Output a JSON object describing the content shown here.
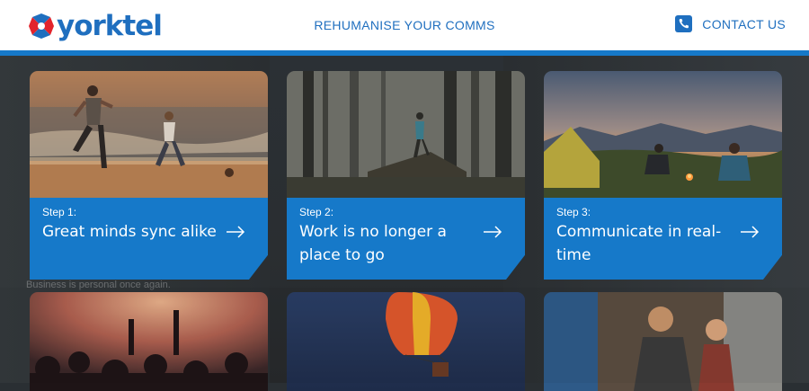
{
  "header": {
    "logo_text": "yorktel",
    "center_link": "REHUMANISE YOUR COMMS",
    "contact_label": "CONTACT US",
    "contact_icon": "phone-icon"
  },
  "background_text": {
    "line1": "Business is personal once again."
  },
  "cards": [
    {
      "step": "Step 1:",
      "title": "Great minds sync alike",
      "icon": "arrow-right-icon"
    },
    {
      "step": "Step 2:",
      "title": "Work is no longer a place to go",
      "icon": "arrow-right-icon"
    },
    {
      "step": "Step 3:",
      "title": "Communicate in real-time",
      "icon": "arrow-right-icon"
    }
  ],
  "colors": {
    "brand_blue": "#1679c9",
    "logo_red": "#e2242c",
    "header_bg": "#ffffff"
  }
}
